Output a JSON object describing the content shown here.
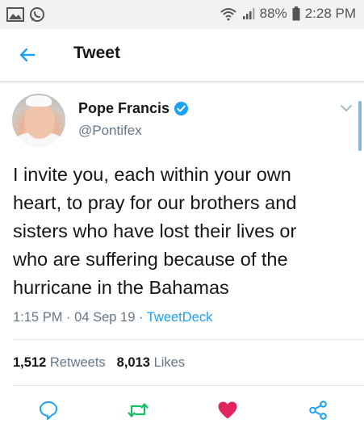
{
  "status_bar": {
    "battery": "88%",
    "time": "2:28 PM"
  },
  "app_bar": {
    "title": "Tweet"
  },
  "tweet": {
    "author_name": "Pope Francis",
    "author_handle": "@Pontifex",
    "verified": true,
    "text": "I invite you, each within your own\nheart, to pray for our brothers and\nsisters who have lost their lives or\nwho are suffering because of the\nhurricane in the Bahamas",
    "time": "1:15 PM",
    "date": "04 Sep 19",
    "source": "TweetDeck",
    "retweet_count": "1,512",
    "retweets_label": "Retweets",
    "like_count": "8,013",
    "likes_label": "Likes",
    "liked": true
  },
  "colors": {
    "accent": "#1da1f2",
    "like": "#e0245e",
    "retweet": "#17bf63",
    "muted": "#657786"
  },
  "icons": {
    "back": "arrow-left-icon",
    "verified": "verified-badge-icon",
    "menu": "chevron-down-icon",
    "reply": "reply-icon",
    "retweet": "retweet-icon",
    "like": "heart-icon",
    "share": "share-icon"
  }
}
